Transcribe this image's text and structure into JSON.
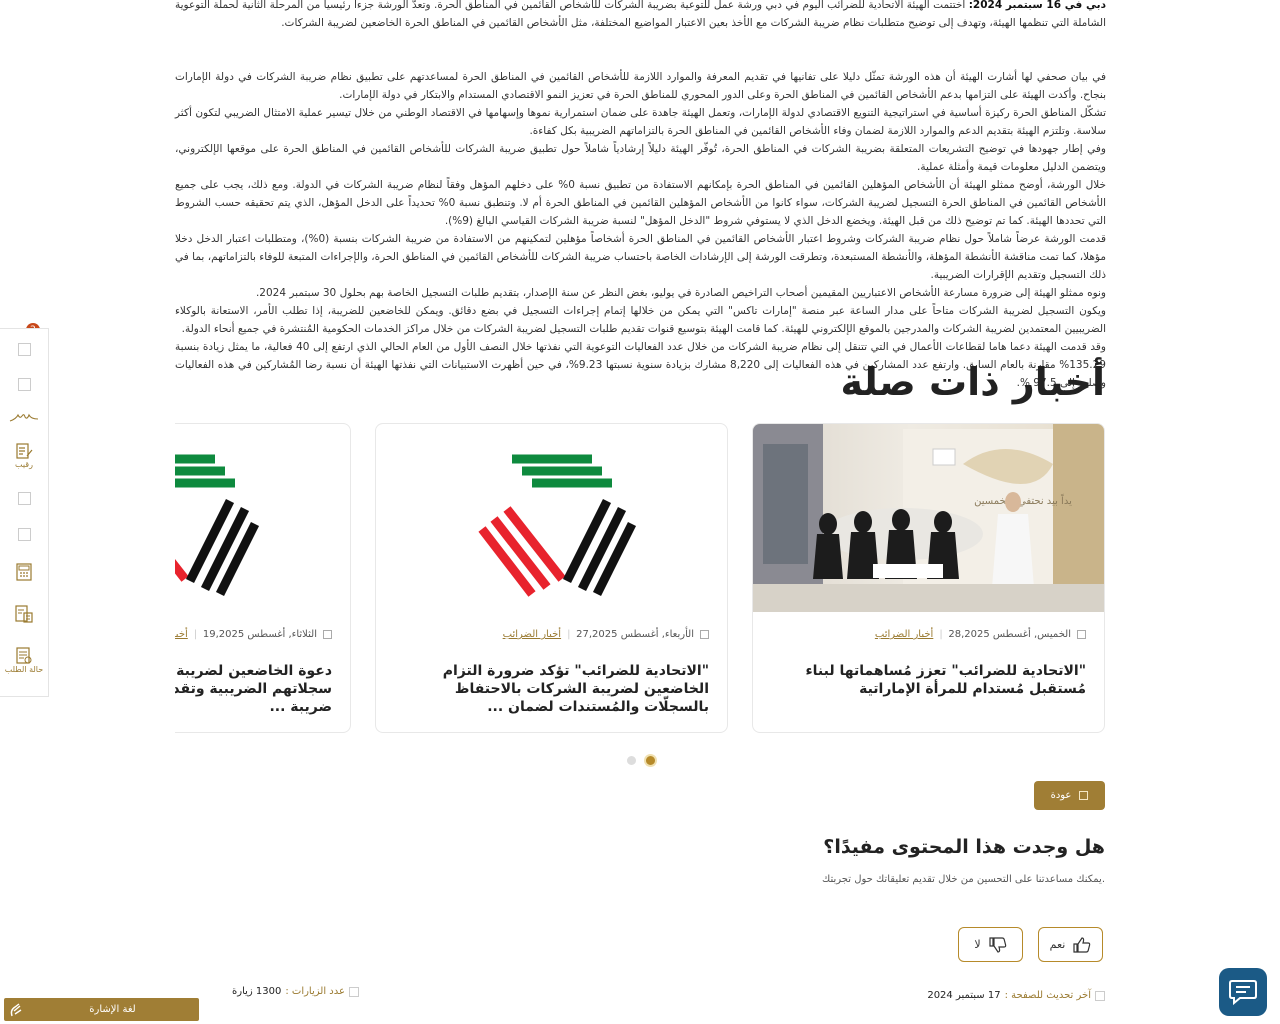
{
  "article": {
    "p1_lead": "دبي في 16 سبتمبر 2024:",
    "p1": " اختتمت الهيئة الاتحادية للضرائب اليوم في دبي ورشة عمل للتوعية بضريبة الشركات للأشخاص القائمين في المناطق الحرة. وتعدّ الورشة جزءاً رئيسياً من المرحلة الثانية لحملة التوعوية الشاملة التي تنظمها الهيئة، وتهدف إلى توضيح متطلبات نظام ضريبة الشركات مع الأخذ بعين الاعتبار المواضيع المختلفة، مثل الأشخاص القائمين في المناطق الحرة الخاضعين لضريبة الشركات.",
    "p2": "في بيان صحفي لها أشارت الهيئة أن هذه الورشة تمثّل دليلا على تفانيها في تقديم المعرفة والموارد اللازمة للأشخاص القائمين  في المناطق الحرة لمساعدتهم على تطبيق نظام ضريبة الشركات في دولة الإمارات بنجاح. وأكدت الهيئة على التزامها بدعم الأشخاص القائمين في المناطق الحرة وعلى الدور المحوري للمناطق الحرة في تعزيز النمو الاقتصادي المستدام والابتكار في دولة الإمارات.",
    "p3": "تشكّل المناطق الحرة ركيزة أساسية في استراتيجية التنويع الاقتصادي لدولة الإمارات، وتعمل الهيئة جاهدة على ضمان استمرارية نموها وإسهامها في الاقتصاد الوطني من خلال تيسير عملية الامتثال الضريبي لتكون أكثر سلاسة. وتلتزم الهيئة بتقديم الدعم والموارد اللازمة لضمان وفاء الأشخاص القائمين في المناطق الحرة بالتزاماتهم الضريبية بكل كفاءة.",
    "p4": "وفي إطار جهودها في توضيح التشريعات المتعلقة بضريبة الشركات في المناطق الحرة، تُوفّر الهيئة دليلاً إرشادياً شاملاً حول تطبيق ضريبة الشركات للأشخاص القائمين في المناطق الحرة على موقعها الإلكتروني، ويتضمن الدليل معلومات قيمة وأمثلة عملية.",
    "p5": "خلال الورشة، أوضح ممثلو الهيئة أن الأشخاص المؤهلين القائمين في المناطق الحرة بإمكانهم الاستفادة من تطبيق نسبة 0% على دخلهم المؤهل وفقاً لنظام ضريبة الشركات في الدولة. ومع ذلك، يجب على جميع الأشخاص القائمين في المناطق الحرة التسجيل لضريبة الشركات، سواء كانوا من الأشخاص المؤهلين القائمين في المناطق الحرة أم لا. وتنطبق نسبة 0% تحديداً على الدخل المؤهل، الذي يتم تحقيقه حسب الشروط التي تحددها الهيئة. كما تم توضيح ذلك من قبل الهيئة. ويخضع الدخل الذي لا يستوفي شروط \"الدخل المؤهل\" لنسبة ضريبة الشركات القياسي البالغ (9%).",
    "p6": "قدمت الورشة عرضاً شاملاً حول نظام ضريبة الشركات وشروط اعتبار الأشخاص القائمين في المناطق الحرة أشخاصاً مؤهلين لتمكينهم من الاستفادة من ضريبة الشركات بنسبة (0%)، ومتطلبات اعتبار الدخل دخلا مؤهلا، كما تمت مناقشة الأنشطة المؤهلة، والأنشطة المستبعدة، وتطرقت الورشة إلى الإرشادات الخاصة باحتساب ضريبة الشركات للأشخاص القائمين في المناطق الحرة، والإجراءات المتبعة للوفاء بالتزاماتهم، بما في ذلك التسجيل وتقديم الإقرارات الضريبية.",
    "p7": "ونوه ممثلو الهيئة إلى ضرورة مسارعة الأشخاص الاعتباريين المقيمين أصحاب التراخيص الصادرة في يوليو، بغض النظر عن سنة الإصدار، بتقديم طلبات التسجيل الخاصة بهم بحلول 30 سبتمبر 2024.",
    "p8": "ويكون التسجيل لضريبة الشركات متاحاً على مدار الساعة عبر منصة \"إمارات تاكس\" التي يمكن من خلالها إتمام إجراءات التسجيل في بضع دقائق. ويمكن للخاضعين للضريبة، إذا تطلب الأمر، الاستعانة بالوكلاء الضريبيين المعتمدين لضريبة الشركات والمدرجين بالموقع الإلكتروني للهيئة. كما قامت الهيئة بتوسيع قنوات تقديم طلبات التسجيل لضريبة الشركات من خلال مراكز الخدمات الحكومية المُنتشرة في جميع أنحاء الدولة.",
    "p9": "وقد  قدمت الهيئة دعما هاما لقطاعات الأعمال في التي تتنقل إلى نظام ضريبة الشركات من خلال عدد الفعاليات التوعوية التي نفذتها خلال النصف الأول من العام الحالي الذي ارتفع إلى 40 فعالية، ما يمثل زيادة بنسبة 135.29% مقارنة بالعام السابق. وارتفع عدد المشاركين في هذه الفعاليات إلى 8,220 مشارك بزيادة سنوية نسبتها 9.23%، في حين أظهرت الاستبيانات التي نفذتها الهيئة أن نسبة رضا المُشاركين في هذه الفعاليات وصلت إلى 97.5 %."
  },
  "related": {
    "title": "أخبار ذات صلة",
    "cards": [
      {
        "date": "الخميس, أغسطس 28,2025",
        "tag": "أخبار الضرائب",
        "title": "\"الاتحادية للضرائب\" تعزز مُساهماتها لبناء مُستقبل مُستدام للمرأة الإماراتية"
      },
      {
        "date": "الأربعاء, أغسطس 27,2025",
        "tag": "أخبار الضرائب",
        "title": "\"الاتحادية للضرائب\" تؤكد ضرورة التزام الخاضعين لضريبة الشركات بالاحتفاظ بالسجلّات والمُستندات لضمان ..."
      },
      {
        "date": "الثلاثاء, أغسطس 19,2025",
        "tag": "أخبار الضرائب",
        "title": "دعوة الخاضعين لضريبة الشركات لتحديث سجلاتهم الضريبية وتقديم الإقرارات وسداد ضريبة ..."
      }
    ],
    "image_banner_text": "يداً بيد نحتفي بالخمسين"
  },
  "back_button": "عودة",
  "feedback": {
    "title": "هل وجدت هذا المحتوى مفيدًا؟",
    "subtitle": "يمكنك مساعدتنا على التحسين من خلال تقديم تعليقاتك حول تجربتك.",
    "yes": "نعم",
    "no": "لا"
  },
  "footer": {
    "last_updated_label": "آخر تحديث للصفحة :",
    "last_updated_value": "17 سبتمبر 2024",
    "visits_label": "عدد الزيارات :",
    "visits_value": "1300 زيارة"
  },
  "sidebar": {
    "badge": "2",
    "items": [
      {
        "name": "empty-1",
        "label": ""
      },
      {
        "name": "empty-2",
        "label": ""
      },
      {
        "name": "signature",
        "label": ""
      },
      {
        "name": "raqeeb",
        "label": "رقيب"
      },
      {
        "name": "empty-3",
        "label": ""
      },
      {
        "name": "empty-4",
        "label": ""
      },
      {
        "name": "calculator",
        "label": ""
      },
      {
        "name": "tax-calc",
        "label": ""
      },
      {
        "name": "request-status",
        "label": "حالة الطلب"
      }
    ]
  },
  "sign_language": "لغة الإشارة",
  "colors": {
    "gold": "#a07e35",
    "chat": "#1b5a86",
    "badge": "#c8481a"
  }
}
